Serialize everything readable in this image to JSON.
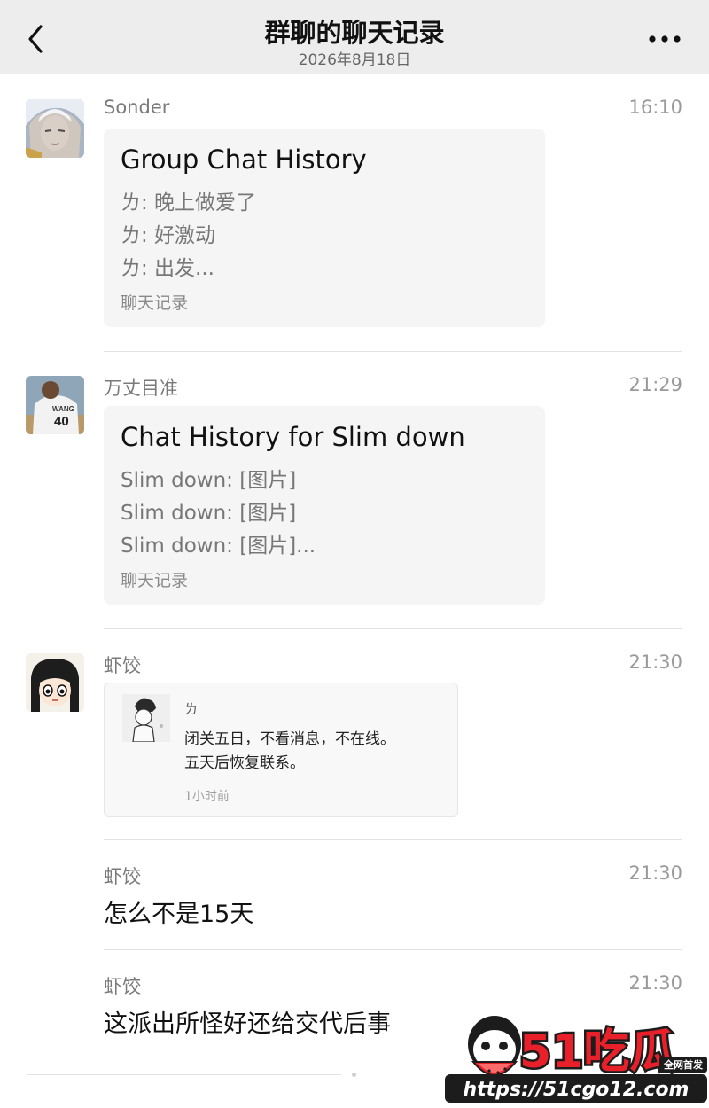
{
  "header": {
    "title": "群聊的聊天记录",
    "date": "2026年8月18日",
    "back_icon": "chevron-left-icon",
    "more_icon": "more-horizontal-icon"
  },
  "messages": [
    {
      "sender": "Sonder",
      "time": "16:10",
      "card": {
        "title": "Group Chat History",
        "lines": [
          "ㄌ: 晚上做爱了",
          "ㄌ: 好激动",
          "ㄌ: 出发..."
        ],
        "footer": "聊天记录"
      }
    },
    {
      "sender": "万丈目准",
      "time": "21:29",
      "card": {
        "title": "Chat History for Slim down",
        "lines": [
          "Slim down: [图片]",
          "Slim down: [图片]",
          "Slim down: [图片]..."
        ],
        "footer": "聊天记录"
      }
    },
    {
      "sender": "虾饺",
      "time": "21:30",
      "quote": {
        "name": "ㄌ",
        "lines": [
          "闭关五日，不看消息，不在线。",
          "五天后恢复联系。"
        ],
        "time": "1小时前"
      }
    },
    {
      "sender": "虾饺",
      "time": "21:30",
      "text": "怎么不是15天"
    },
    {
      "sender": "虾饺",
      "time": "21:30",
      "text": "这派出所怪好还给交代后事"
    }
  ],
  "watermark": {
    "logo_text": "51吃瓜",
    "tag": "全网首发",
    "url": "https://51cgo12.com"
  },
  "colors": {
    "header_bg": "#ededed",
    "card_bg": "#f5f5f5",
    "watermark_red": "#e8202a"
  }
}
